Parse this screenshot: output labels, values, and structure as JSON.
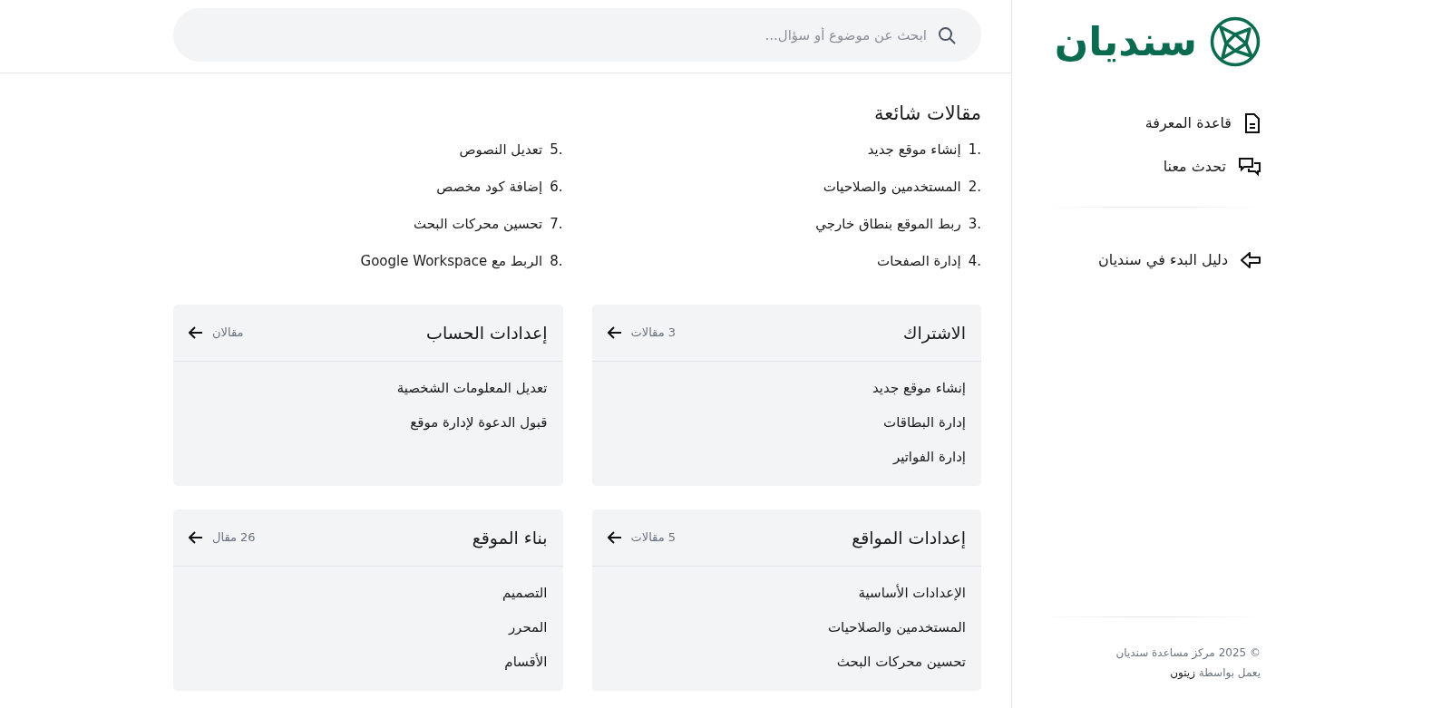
{
  "logo": {
    "text": "سنديان"
  },
  "sidebar": {
    "items": [
      {
        "label": "قاعدة المعرفة",
        "kind": "doc"
      },
      {
        "label": "تحدث معنا",
        "kind": "chat"
      }
    ],
    "guide": {
      "label": "دليل البدء في سنديان"
    }
  },
  "footer": {
    "copyright": "© 2025 مركز مساعدة سنديان",
    "powered_prefix": "يعمل بواسطة",
    "powered_brand": "زيتون"
  },
  "search": {
    "placeholder": "ابحث عن موضوع أو سؤال..."
  },
  "popular": {
    "title": "مقالات شائعة",
    "articles": [
      {
        "number": "1.",
        "title": "إنشاء موقع جديد"
      },
      {
        "number": "2.",
        "title": "المستخدمين والصلاحيات"
      },
      {
        "number": "3.",
        "title": "ربط الموقع بنطاق خارجي"
      },
      {
        "number": "4.",
        "title": "إدارة الصفحات"
      },
      {
        "number": "5.",
        "title": "تعديل النصوص"
      },
      {
        "number": "6.",
        "title": "إضافة كود مخصص"
      },
      {
        "number": "7.",
        "title": "تحسين محركات البحث"
      },
      {
        "number": "8.",
        "title": "الربط مع Google Workspace"
      }
    ]
  },
  "categories": [
    {
      "title": "الاشتراك",
      "count": "3 مقالات",
      "articles": [
        "إنشاء موقع جديد",
        "إدارة البطاقات",
        "إدارة الفواتير"
      ]
    },
    {
      "title": "إعدادات الحساب",
      "count": "مقالان",
      "articles": [
        "تعديل المعلومات الشخصية",
        "قبول الدعوة لإدارة موقع"
      ]
    },
    {
      "title": "إعدادات المواقع",
      "count": "5 مقالات",
      "articles": [
        "الإعدادات الأساسية",
        "المستخدمين والصلاحيات",
        "تحسين محركات البحث"
      ]
    },
    {
      "title": "بناء الموقع",
      "count": "26 مقال",
      "articles": [
        "التصميم",
        "المحرر",
        "الأقسام"
      ]
    }
  ]
}
